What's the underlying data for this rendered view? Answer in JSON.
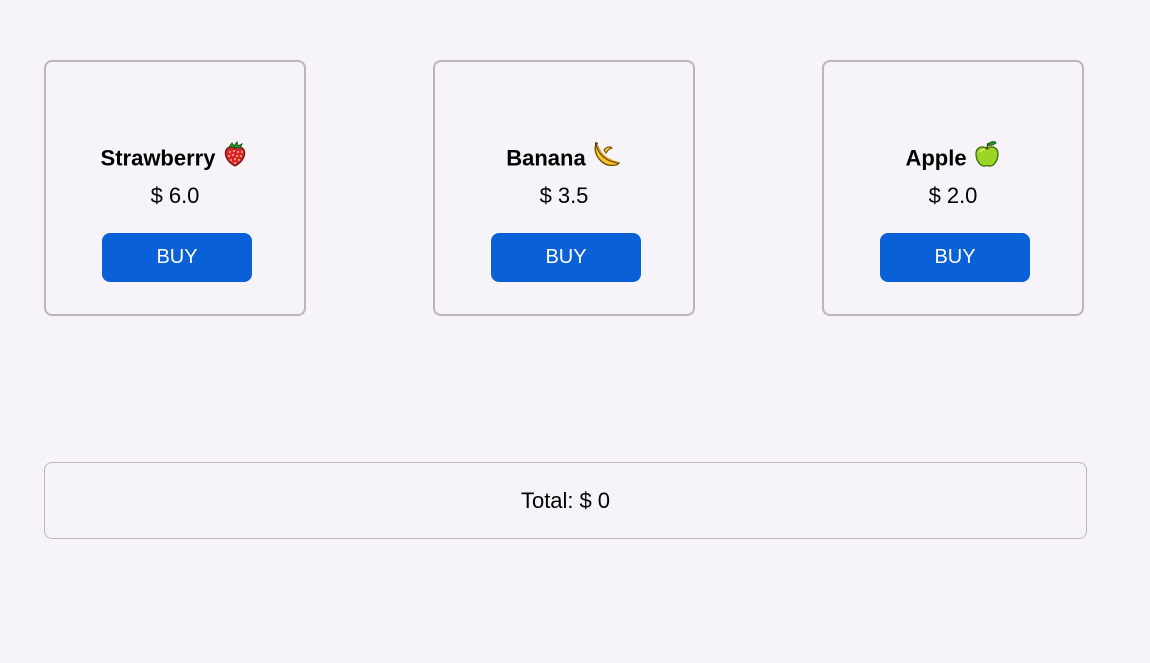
{
  "products": [
    {
      "name": "Strawberry",
      "emoji": "strawberry-icon",
      "currency": "$",
      "price": "6.0",
      "button_label": "BUY"
    },
    {
      "name": "Banana",
      "emoji": "banana-icon",
      "currency": "$",
      "price": "3.5",
      "button_label": "BUY"
    },
    {
      "name": "Apple",
      "emoji": "green-apple-icon",
      "currency": "$",
      "price": "2.0",
      "button_label": "BUY"
    }
  ],
  "total": {
    "label": "Total:",
    "currency": "$",
    "value": "0"
  },
  "colors": {
    "background": "#f6f4f8",
    "card_border": "#bcb6b8",
    "button": "#0a60d6",
    "button_text": "#ffffff"
  }
}
